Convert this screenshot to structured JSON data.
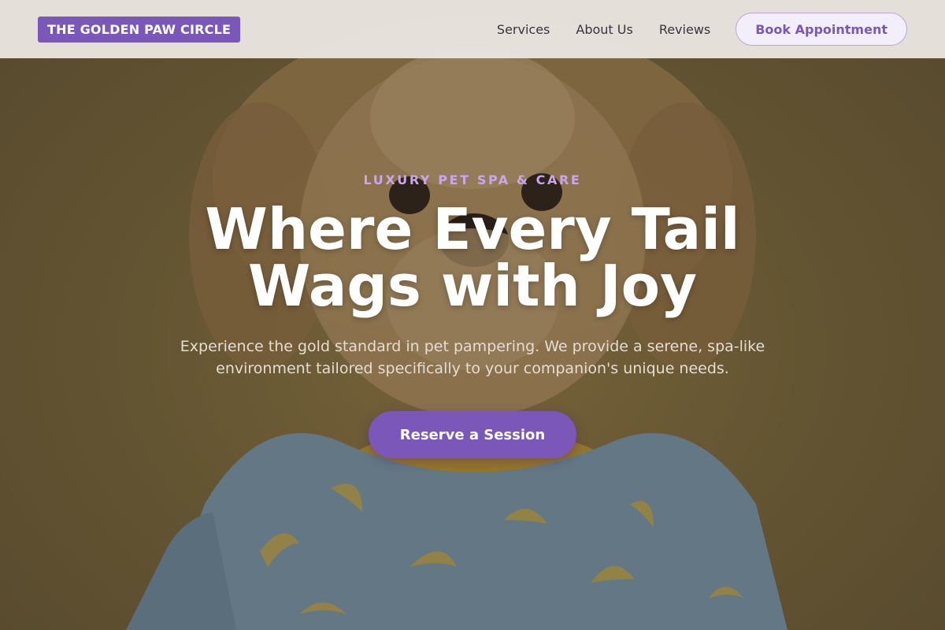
{
  "header": {
    "logo_text": "THE GOLDEN PAW CIRCLE",
    "nav": [
      {
        "label": "Services"
      },
      {
        "label": "About Us"
      },
      {
        "label": "Reviews"
      }
    ],
    "cta_label": "Book Appointment"
  },
  "hero": {
    "eyebrow": "LUXURY PET SPA & CARE",
    "headline_line1": "Where Every Tail",
    "headline_line2": "Wags with Joy",
    "subtext": "Experience the gold standard in pet pampering. We provide a serene, spa-like environment tailored specifically to your companion's unique needs.",
    "cta_label": "Reserve a Session",
    "background_image": "fluffy-dog-in-banana-shirt"
  },
  "colors": {
    "accent": "#7a57b8",
    "eyebrow": "#c8a6f0",
    "header_bg": "#e8e4de",
    "hero_bg": "#6e5c38"
  }
}
